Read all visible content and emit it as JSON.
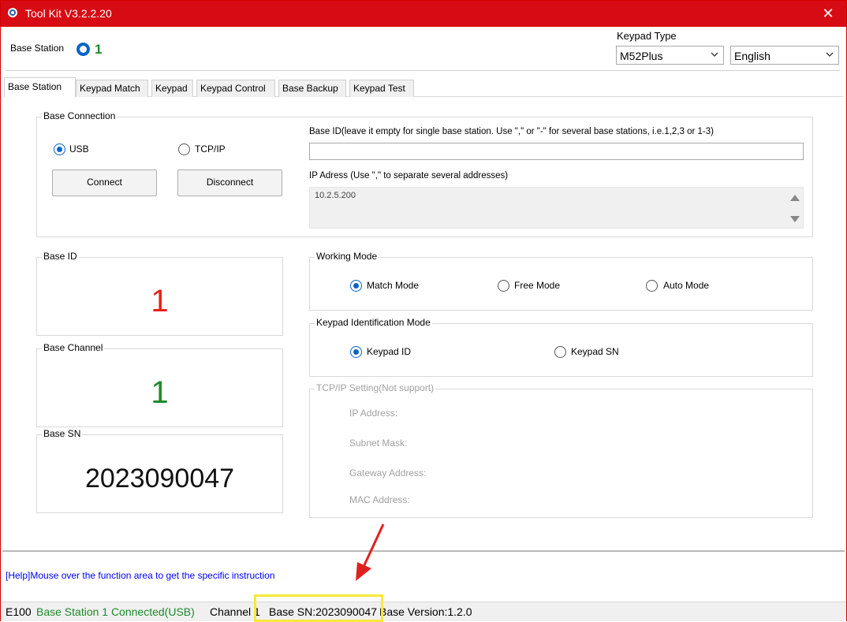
{
  "window": {
    "title": "Tool Kit  V3.2.2.20",
    "close_glyph": "✕"
  },
  "header": {
    "base_station_label": "Base Station",
    "base_station_value": "1",
    "keypad_type_label": "Keypad Type",
    "keypad_type_value": "M52Plus",
    "language_value": "English"
  },
  "tabs": [
    {
      "label": "Base Station"
    },
    {
      "label": "Keypad Match"
    },
    {
      "label": "Keypad"
    },
    {
      "label": "Keypad Control"
    },
    {
      "label": "Base Backup"
    },
    {
      "label": "Keypad Test"
    }
  ],
  "base_connection": {
    "title": "Base Connection",
    "usb_label": "USB",
    "tcpip_label": "TCP/IP",
    "connect_label": "Connect",
    "disconnect_label": "Disconnect",
    "base_id_hint": "Base ID(leave it empty for single base station. Use \",\" or \"-\" for several base stations, i.e.1,2,3 or 1-3)",
    "base_id_value": "",
    "ip_hint": "IP Adress (Use \",\" to separate several addresses)",
    "ip_value": "10.2.5.200"
  },
  "base_id": {
    "title": "Base ID",
    "value": "1",
    "color": "#e8201c"
  },
  "base_channel": {
    "title": "Base Channel",
    "value": "1",
    "color": "#1e8a2a"
  },
  "base_sn": {
    "title": "Base SN",
    "value": "2023090047"
  },
  "working_mode": {
    "title": "Working Mode",
    "options": [
      "Match Mode",
      "Free Mode",
      "Auto Mode"
    ],
    "selected": "Match Mode"
  },
  "keypad_id_mode": {
    "title": "Keypad Identification Mode",
    "options": [
      "Keypad ID",
      "Keypad SN"
    ],
    "selected": "Keypad ID"
  },
  "tcpip_setting": {
    "title": "TCP/IP Setting(Not support)",
    "ip_label": "IP Address:",
    "subnet_label": "Subnet Mask:",
    "gateway_label": "Gateway Address:",
    "mac_label": "MAC Address:"
  },
  "help": {
    "text": "[Help]Mouse over the function area to get the specific instruction"
  },
  "status": {
    "model": "E100",
    "connection": "Base Station 1 Connected(USB)",
    "channel": "Channel 1",
    "sn": "Base SN:2023090047",
    "version": "Base Version:1.2.0",
    "connection_color": "#1e8a2a"
  },
  "colors": {
    "titlebar": "#d70b13",
    "accent": "#0a64c8",
    "annotation_arrow": "#e02020",
    "annotation_box": "#f7e83a"
  }
}
